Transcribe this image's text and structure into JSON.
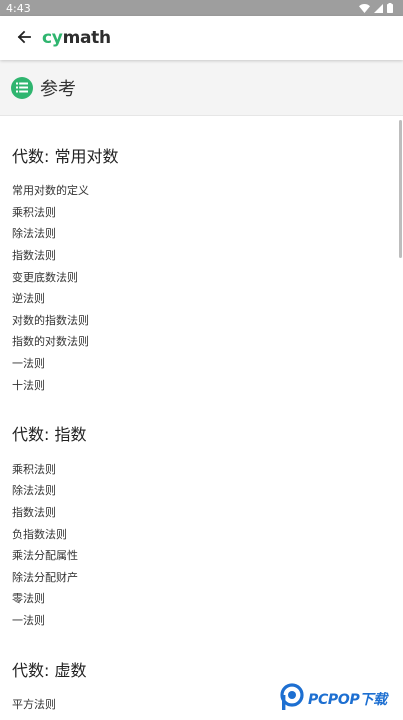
{
  "status_bar": {
    "time": "4:43"
  },
  "app_bar": {
    "back_icon": "arrow-left-icon",
    "logo_cy": "cy",
    "logo_math": "math"
  },
  "reference_header": {
    "icon": "list-icon",
    "title": "参考"
  },
  "sections": [
    {
      "title": "代数: 常用对数",
      "items": [
        "常用对数的定义",
        "乘积法则",
        "除法法则",
        "指数法则",
        "变更底数法则",
        "逆法则",
        "对数的指数法则",
        "指数的对数法则",
        "一法则",
        "十法则"
      ]
    },
    {
      "title": "代数: 指数",
      "items": [
        "乘积法则",
        "除法法则",
        "指数法则",
        "负指数法则",
        "乘法分配属性",
        "除法分配财产",
        "零法则",
        "一法则"
      ]
    },
    {
      "title": "代数: 虚数",
      "items": [
        "平方法则"
      ]
    }
  ],
  "watermark": {
    "text": "PCPOP下载"
  },
  "colors": {
    "accent": "#2fb56f",
    "status_bar": "#9e9e9e",
    "header_bg": "#f4f4f4",
    "watermark": "#1d6fd1"
  }
}
